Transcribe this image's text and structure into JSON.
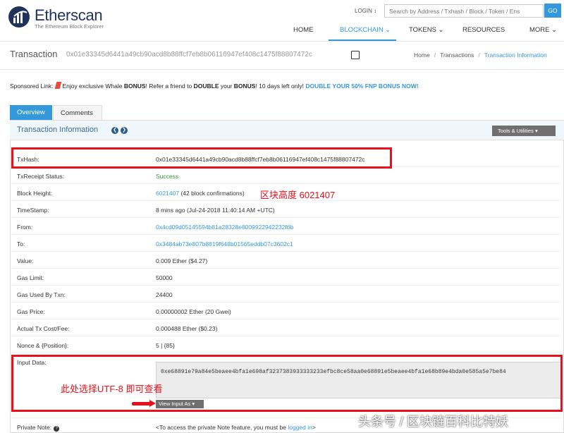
{
  "header": {
    "logo_name": "Etherscan",
    "logo_tagline": "The Ethereum Block Explorer",
    "login": "LOGIN",
    "search_placeholder": "Search by Address / Txhash / Block / Token / Ens",
    "go": "GO",
    "nav": [
      "HOME",
      "BLOCKCHAIN",
      "TOKENS",
      "RESOURCES",
      "MORE"
    ],
    "active_nav": "BLOCKCHAIN"
  },
  "page": {
    "title": "Transaction",
    "hash": "0x01e33345d6441a49cb90acd8b88ffcf7eb8b06116947ef408c1475f88807472c",
    "breadcrumb": [
      "Home",
      "Transactions",
      "Transaction Information"
    ]
  },
  "sponsor": {
    "label": "Sponsored Link:",
    "text1": "Enjoy exclusive Whale ",
    "bonus1": "BONUS",
    "text2": "! Refer a friend to ",
    "double": "DOUBLE",
    "text3": " your ",
    "bonus2": "BONUS",
    "text4": "! 10 days left only! ",
    "link": "DOUBLE YOUR 50% FNP BONUS NOW!"
  },
  "tabs": [
    "Overview",
    "Comments"
  ],
  "panel": {
    "title": "Transaction Information",
    "tools": "Tools & Utilities"
  },
  "fields": {
    "txhash": {
      "label": "TxHash:",
      "value": "0x01e33345d6441a49cb90acd8b88ffcf7eb8b06116947ef408c1475f88807472c"
    },
    "status": {
      "label": "TxReceipt Status:",
      "value": "Success"
    },
    "block": {
      "label": "Block Height:",
      "value": "6021407",
      "extra": " (42 block confirmations)"
    },
    "timestamp": {
      "label": "TimeStamp:",
      "value": "8 mins ago (Jul-24-2018 11:40:14 AM +UTC)"
    },
    "from": {
      "label": "From:",
      "value": "0x4cd09d05145594b81a28328e8009922942232f6b"
    },
    "to": {
      "label": "To:",
      "value": "0x3484ab73e807b8819f648b01565eddb07c3602c1"
    },
    "value": {
      "label": "Value:",
      "value": "0.009 Ether ($4.27)"
    },
    "gas_limit": {
      "label": "Gas Limit:",
      "value": "50000"
    },
    "gas_used": {
      "label": "Gas Used By Txn:",
      "value": "24400"
    },
    "gas_price": {
      "label": "Gas Price:",
      "value": "0.00000002 Ether (20 Gwei)"
    },
    "tx_cost": {
      "label": "Actual Tx Cost/Fee:",
      "value": "0.000488 Ether ($0.23)"
    },
    "nonce": {
      "label": "Nonce & {Position}:",
      "value": "5 | {85}"
    },
    "input": {
      "label": "Input Data:",
      "value": "0xe68891e79a84e5beaee4bfa1e698af3237383933333233efbc8ce58aa0e68891e5beaee4bfa1e68b89e4bda0e585a5e7be84",
      "view_as": "View Input As"
    },
    "private_note": {
      "label": "Private Note:",
      "text": "<To access the private Note feature, you must be ",
      "link": "logged in",
      "end": ">"
    }
  },
  "annotations": {
    "block_note": "区块高度 6021407",
    "utf8_note": "此处选择UTF-8 即可查看"
  },
  "watermark": "头条号 / 区块链百科比特妖"
}
